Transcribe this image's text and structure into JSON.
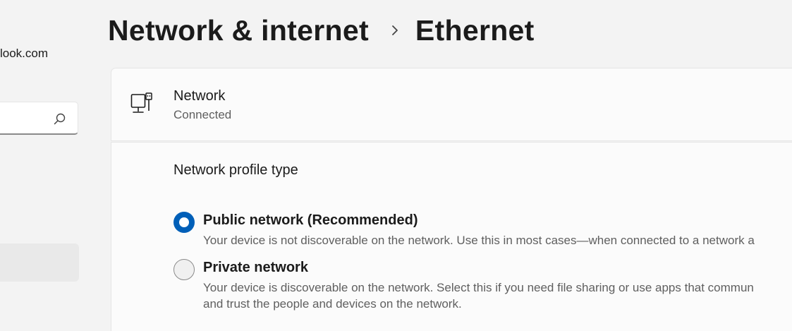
{
  "sidebar": {
    "account_email": "look.com",
    "search": {
      "placeholder": "",
      "value": "",
      "icon": "search-icon"
    }
  },
  "breadcrumb": {
    "parent": "Network & internet",
    "separator_icon": "chevron-right-icon",
    "current": "Ethernet"
  },
  "network": {
    "icon": "ethernet-network-icon",
    "title": "Network",
    "status": "Connected"
  },
  "profile": {
    "heading": "Network profile type",
    "options": [
      {
        "label": "Public network (Recommended)",
        "description": "Your device is not discoverable on the network. Use this in most cases—when connected to a network a",
        "selected": true
      },
      {
        "label": "Private network",
        "description_line1": "Your device is discoverable on the network. Select this if you need file sharing or use apps that commun",
        "description_line2": "and trust the people and devices on the network.",
        "selected": false
      }
    ]
  },
  "colors": {
    "accent": "#005fb8",
    "background": "#f3f3f3",
    "card": "#fbfbfb"
  }
}
